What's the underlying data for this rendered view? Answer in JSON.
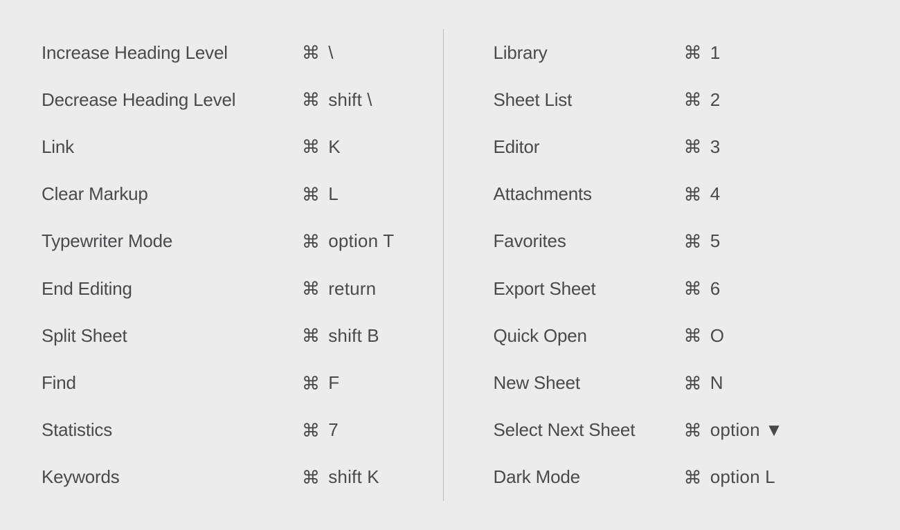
{
  "cmd_symbol": "⌘",
  "left": [
    {
      "label": "Increase Heading Level",
      "keys": [
        "⌘",
        "\\"
      ]
    },
    {
      "label": "Decrease Heading Level",
      "keys": [
        "⌘",
        "shift \\"
      ]
    },
    {
      "label": "Link",
      "keys": [
        "⌘",
        "K"
      ]
    },
    {
      "label": "Clear Markup",
      "keys": [
        "⌘",
        "L"
      ]
    },
    {
      "label": "Typewriter Mode",
      "keys": [
        "⌘",
        "option T"
      ]
    },
    {
      "label": "End Editing",
      "keys": [
        "⌘",
        "return"
      ]
    },
    {
      "label": "Split Sheet",
      "keys": [
        "⌘",
        "shift B"
      ]
    },
    {
      "label": "Find",
      "keys": [
        "⌘",
        "F"
      ]
    },
    {
      "label": "Statistics",
      "keys": [
        "⌘",
        "7"
      ]
    },
    {
      "label": "Keywords",
      "keys": [
        "⌘",
        "shift K"
      ]
    }
  ],
  "right": [
    {
      "label": "Library",
      "keys": [
        "⌘",
        "1"
      ]
    },
    {
      "label": "Sheet List",
      "keys": [
        "⌘",
        "2"
      ]
    },
    {
      "label": "Editor",
      "keys": [
        "⌘",
        "3"
      ]
    },
    {
      "label": "Attachments",
      "keys": [
        "⌘",
        "4"
      ]
    },
    {
      "label": "Favorites",
      "keys": [
        "⌘",
        "5"
      ]
    },
    {
      "label": "Export Sheet",
      "keys": [
        "⌘",
        "6"
      ]
    },
    {
      "label": "Quick Open",
      "keys": [
        "⌘",
        "O"
      ]
    },
    {
      "label": "New Sheet",
      "keys": [
        "⌘",
        "N"
      ]
    },
    {
      "label": "Select Next Sheet",
      "keys": [
        "⌘",
        "option ▼"
      ]
    },
    {
      "label": "Dark Mode",
      "keys": [
        "⌘",
        "option L"
      ]
    }
  ]
}
